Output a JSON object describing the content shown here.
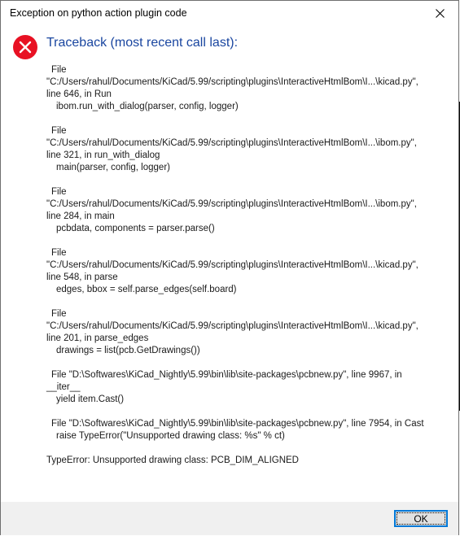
{
  "dialog": {
    "title": "Exception on python action plugin code",
    "close_icon": "close-icon",
    "error_icon": "error-icon",
    "error_icon_color": "#e81123",
    "heading": "Traceback (most recent call last):",
    "heading_color": "#1a46a0",
    "frames": [
      {
        "file_label": "File",
        "path": "\"C:/Users/rahul/Documents/KiCad/5.99/scripting\\plugins\\InteractiveHtmlBom\\I...\\kicad.py\",",
        "location": "line 646, in Run",
        "code": "ibom.run_with_dialog(parser, config, logger)"
      },
      {
        "file_label": "File",
        "path": "\"C:/Users/rahul/Documents/KiCad/5.99/scripting\\plugins\\InteractiveHtmlBom\\I...\\ibom.py\",",
        "location": "line 321, in run_with_dialog",
        "code": "main(parser, config, logger)"
      },
      {
        "file_label": "File",
        "path": "\"C:/Users/rahul/Documents/KiCad/5.99/scripting\\plugins\\InteractiveHtmlBom\\I...\\ibom.py\",",
        "location": "line 284, in main",
        "code": "pcbdata, components = parser.parse()"
      },
      {
        "file_label": "File",
        "path": "\"C:/Users/rahul/Documents/KiCad/5.99/scripting\\plugins\\InteractiveHtmlBom\\I...\\kicad.py\",",
        "location": "line 548, in parse",
        "code": "edges, bbox = self.parse_edges(self.board)"
      },
      {
        "file_label": "File",
        "path": "\"C:/Users/rahul/Documents/KiCad/5.99/scripting\\plugins\\InteractiveHtmlBom\\I...\\kicad.py\",",
        "location": "line 201, in parse_edges",
        "code": "drawings = list(pcb.GetDrawings())"
      },
      {
        "file_label": "",
        "path": "File \"D:\\Softwares\\KiCad_Nightly\\5.99\\bin\\lib\\site-packages\\pcbnew.py\", line 9967, in",
        "location": "__iter__",
        "code": "yield item.Cast()"
      },
      {
        "file_label": "",
        "path": "File \"D:\\Softwares\\KiCad_Nightly\\5.99\\bin\\lib\\site-packages\\pcbnew.py\", line 7954, in Cast",
        "location": "",
        "code": "raise TypeError(\"Unsupported drawing class: %s\" % ct)"
      }
    ],
    "error_message": "TypeError: Unsupported drawing class: PCB_DIM_ALIGNED",
    "ok_label": "OK",
    "ok_border_color": "#0078d7"
  }
}
